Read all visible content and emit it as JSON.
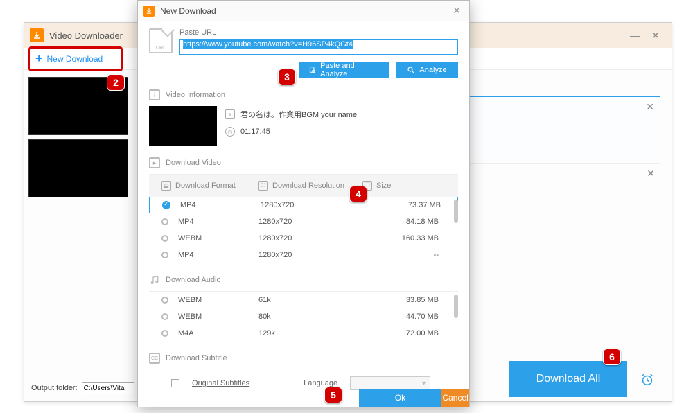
{
  "main": {
    "title": "Video Downloader",
    "newDownload": "New Download",
    "outputFolderLabel": "Output folder:",
    "outputFolderValue": "C:\\Users\\Vita",
    "downloadAll": "Download All"
  },
  "modal": {
    "title": "New Download",
    "pasteUrlLabel": "Paste URL",
    "urlIconLabel": "URL",
    "url": "https://www.youtube.com/watch?v=H96SP4kQGt4",
    "pasteAnalyze": "Paste and Analyze",
    "analyze": "Analyze",
    "videoInfoLabel": "Video Information",
    "videoTitle": "君の名は。作業用BGM your name",
    "videoDuration": "01:17:45",
    "downloadVideoLabel": "Download Video",
    "headers": {
      "format": "Download Format",
      "resolution": "Download Resolution",
      "size": "Size"
    },
    "videoRows": [
      {
        "format": "MP4",
        "resolution": "1280x720",
        "size": "73.37 MB",
        "selected": true
      },
      {
        "format": "MP4",
        "resolution": "1280x720",
        "size": "84.18 MB",
        "selected": false
      },
      {
        "format": "WEBM",
        "resolution": "1280x720",
        "size": "160.33 MB",
        "selected": false
      },
      {
        "format": "MP4",
        "resolution": "1280x720",
        "size": "--",
        "selected": false
      }
    ],
    "downloadAudioLabel": "Download Audio",
    "audioRows": [
      {
        "format": "WEBM",
        "resolution": "61k",
        "size": "33.85 MB"
      },
      {
        "format": "WEBM",
        "resolution": "80k",
        "size": "44.70 MB"
      },
      {
        "format": "M4A",
        "resolution": "129k",
        "size": "72.00 MB"
      }
    ],
    "downloadSubtitleLabel": "Download Subtitle",
    "originalSubtitles": "Original Subtitles",
    "languageLabel": "Language",
    "ok": "Ok",
    "cancel": "Cancel"
  },
  "badges": {
    "b2": "2",
    "b3": "3",
    "b4": "4",
    "b5": "5",
    "b6": "6"
  }
}
